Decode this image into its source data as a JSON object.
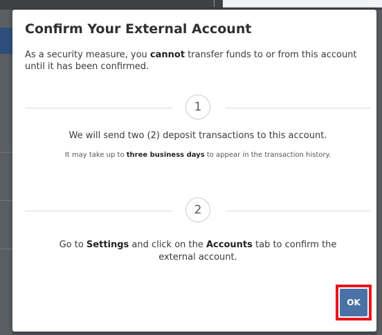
{
  "modal": {
    "title": "Confirm Your External Account",
    "intro": {
      "before": "As a security measure, you ",
      "emphasis": "cannot",
      "after": " transfer funds to or from this account until it has been confirmed."
    },
    "steps": [
      {
        "number": "1",
        "text": "We will send two (2) deposit transactions to this account.",
        "subtext": {
          "before": "It may take up to ",
          "emphasis": "three business days",
          "after": " to appear in the transaction history."
        }
      },
      {
        "number": "2",
        "text": {
          "before": "Go to ",
          "emphasis1": "Settings",
          "middle": " and click on the ",
          "emphasis2": "Accounts",
          "after": " tab to confirm the external account."
        }
      }
    ],
    "ok_label": "OK"
  },
  "colors": {
    "ok_button": "#4a72a6",
    "highlight_border": "#e8151b",
    "title_text": "#2f2f2f"
  }
}
